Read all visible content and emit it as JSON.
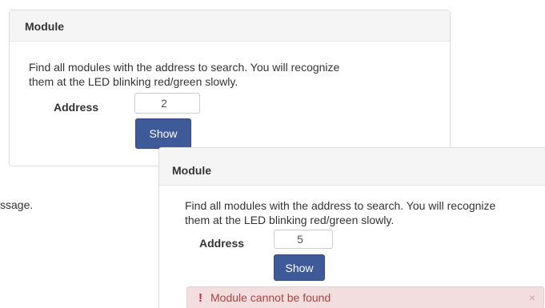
{
  "side_text": "ssage.",
  "panel1": {
    "heading": "Module",
    "line1": "Find all modules with the address to search. You will recognize",
    "line2": "them at the LED blinking red/green slowly.",
    "address_label": "Address",
    "address_value": "2",
    "show_label": "Show"
  },
  "panel2": {
    "heading": "Module",
    "line1": "Find all modules with the address to search. You will recognize",
    "line2": "them at the LED blinking red/green slowly.",
    "address_label": "Address",
    "address_value": "5",
    "show_label": "Show",
    "alert": {
      "icon": "!",
      "icon_name": "exclamation-icon",
      "text": "Module cannot be found",
      "close": "×",
      "close_icon_name": "close-icon"
    }
  },
  "colors": {
    "button": "#3f5a99",
    "alert_bg": "#f2dede",
    "alert_text": "#a94442",
    "heading_bg": "#f5f5f5"
  }
}
